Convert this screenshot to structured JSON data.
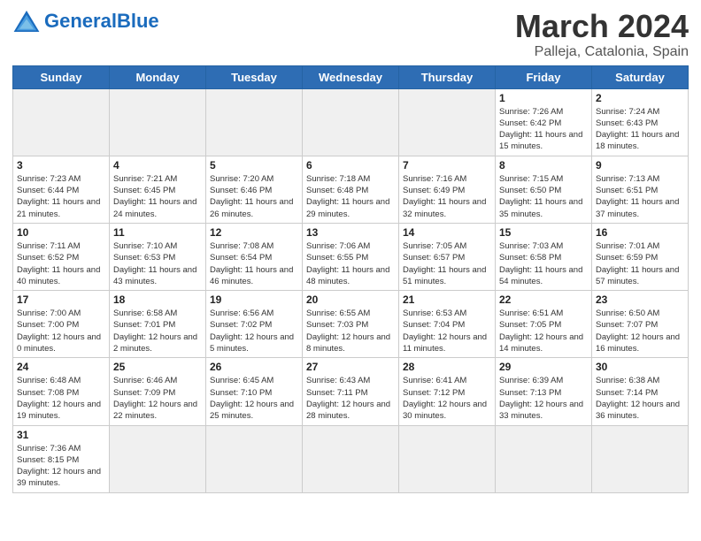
{
  "header": {
    "logo_general": "General",
    "logo_blue": "Blue",
    "month_title": "March 2024",
    "location": "Palleja, Catalonia, Spain"
  },
  "weekdays": [
    "Sunday",
    "Monday",
    "Tuesday",
    "Wednesday",
    "Thursday",
    "Friday",
    "Saturday"
  ],
  "weeks": [
    [
      {
        "day": "",
        "info": ""
      },
      {
        "day": "",
        "info": ""
      },
      {
        "day": "",
        "info": ""
      },
      {
        "day": "",
        "info": ""
      },
      {
        "day": "",
        "info": ""
      },
      {
        "day": "1",
        "info": "Sunrise: 7:26 AM\nSunset: 6:42 PM\nDaylight: 11 hours and 15 minutes."
      },
      {
        "day": "2",
        "info": "Sunrise: 7:24 AM\nSunset: 6:43 PM\nDaylight: 11 hours and 18 minutes."
      }
    ],
    [
      {
        "day": "3",
        "info": "Sunrise: 7:23 AM\nSunset: 6:44 PM\nDaylight: 11 hours and 21 minutes."
      },
      {
        "day": "4",
        "info": "Sunrise: 7:21 AM\nSunset: 6:45 PM\nDaylight: 11 hours and 24 minutes."
      },
      {
        "day": "5",
        "info": "Sunrise: 7:20 AM\nSunset: 6:46 PM\nDaylight: 11 hours and 26 minutes."
      },
      {
        "day": "6",
        "info": "Sunrise: 7:18 AM\nSunset: 6:48 PM\nDaylight: 11 hours and 29 minutes."
      },
      {
        "day": "7",
        "info": "Sunrise: 7:16 AM\nSunset: 6:49 PM\nDaylight: 11 hours and 32 minutes."
      },
      {
        "day": "8",
        "info": "Sunrise: 7:15 AM\nSunset: 6:50 PM\nDaylight: 11 hours and 35 minutes."
      },
      {
        "day": "9",
        "info": "Sunrise: 7:13 AM\nSunset: 6:51 PM\nDaylight: 11 hours and 37 minutes."
      }
    ],
    [
      {
        "day": "10",
        "info": "Sunrise: 7:11 AM\nSunset: 6:52 PM\nDaylight: 11 hours and 40 minutes."
      },
      {
        "day": "11",
        "info": "Sunrise: 7:10 AM\nSunset: 6:53 PM\nDaylight: 11 hours and 43 minutes."
      },
      {
        "day": "12",
        "info": "Sunrise: 7:08 AM\nSunset: 6:54 PM\nDaylight: 11 hours and 46 minutes."
      },
      {
        "day": "13",
        "info": "Sunrise: 7:06 AM\nSunset: 6:55 PM\nDaylight: 11 hours and 48 minutes."
      },
      {
        "day": "14",
        "info": "Sunrise: 7:05 AM\nSunset: 6:57 PM\nDaylight: 11 hours and 51 minutes."
      },
      {
        "day": "15",
        "info": "Sunrise: 7:03 AM\nSunset: 6:58 PM\nDaylight: 11 hours and 54 minutes."
      },
      {
        "day": "16",
        "info": "Sunrise: 7:01 AM\nSunset: 6:59 PM\nDaylight: 11 hours and 57 minutes."
      }
    ],
    [
      {
        "day": "17",
        "info": "Sunrise: 7:00 AM\nSunset: 7:00 PM\nDaylight: 12 hours and 0 minutes."
      },
      {
        "day": "18",
        "info": "Sunrise: 6:58 AM\nSunset: 7:01 PM\nDaylight: 12 hours and 2 minutes."
      },
      {
        "day": "19",
        "info": "Sunrise: 6:56 AM\nSunset: 7:02 PM\nDaylight: 12 hours and 5 minutes."
      },
      {
        "day": "20",
        "info": "Sunrise: 6:55 AM\nSunset: 7:03 PM\nDaylight: 12 hours and 8 minutes."
      },
      {
        "day": "21",
        "info": "Sunrise: 6:53 AM\nSunset: 7:04 PM\nDaylight: 12 hours and 11 minutes."
      },
      {
        "day": "22",
        "info": "Sunrise: 6:51 AM\nSunset: 7:05 PM\nDaylight: 12 hours and 14 minutes."
      },
      {
        "day": "23",
        "info": "Sunrise: 6:50 AM\nSunset: 7:07 PM\nDaylight: 12 hours and 16 minutes."
      }
    ],
    [
      {
        "day": "24",
        "info": "Sunrise: 6:48 AM\nSunset: 7:08 PM\nDaylight: 12 hours and 19 minutes."
      },
      {
        "day": "25",
        "info": "Sunrise: 6:46 AM\nSunset: 7:09 PM\nDaylight: 12 hours and 22 minutes."
      },
      {
        "day": "26",
        "info": "Sunrise: 6:45 AM\nSunset: 7:10 PM\nDaylight: 12 hours and 25 minutes."
      },
      {
        "day": "27",
        "info": "Sunrise: 6:43 AM\nSunset: 7:11 PM\nDaylight: 12 hours and 28 minutes."
      },
      {
        "day": "28",
        "info": "Sunrise: 6:41 AM\nSunset: 7:12 PM\nDaylight: 12 hours and 30 minutes."
      },
      {
        "day": "29",
        "info": "Sunrise: 6:39 AM\nSunset: 7:13 PM\nDaylight: 12 hours and 33 minutes."
      },
      {
        "day": "30",
        "info": "Sunrise: 6:38 AM\nSunset: 7:14 PM\nDaylight: 12 hours and 36 minutes."
      }
    ],
    [
      {
        "day": "31",
        "info": "Sunrise: 7:36 AM\nSunset: 8:15 PM\nDaylight: 12 hours and 39 minutes."
      },
      {
        "day": "",
        "info": ""
      },
      {
        "day": "",
        "info": ""
      },
      {
        "day": "",
        "info": ""
      },
      {
        "day": "",
        "info": ""
      },
      {
        "day": "",
        "info": ""
      },
      {
        "day": "",
        "info": ""
      }
    ]
  ]
}
